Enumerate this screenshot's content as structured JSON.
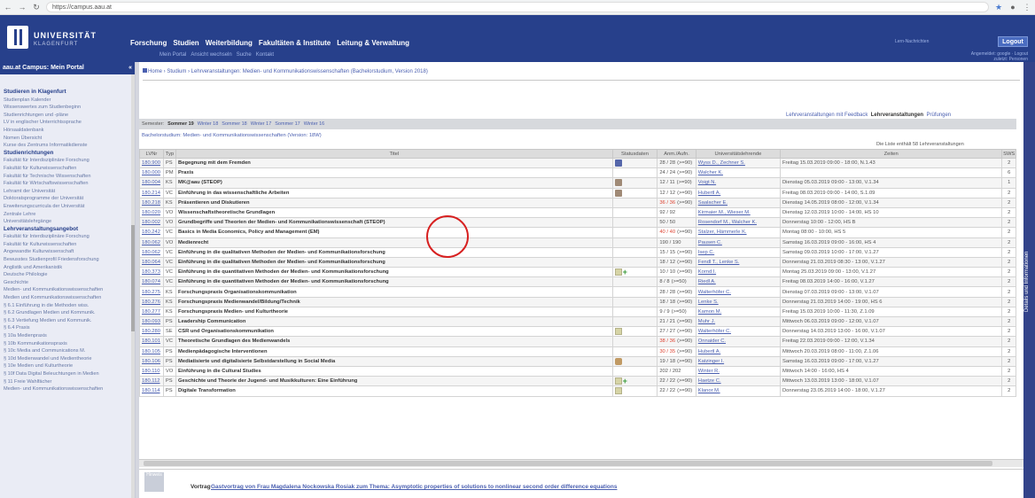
{
  "browser": {
    "url": "https://campus.aau.at"
  },
  "banner": {
    "logo_main": "UNIVERSITÄT",
    "logo_sub": "KLAGENFURT",
    "nav": [
      "Forschung",
      "Studien",
      "Weiterbildung",
      "Fakultäten & Institute",
      "Leitung & Verwaltung"
    ],
    "subnav": [
      "Mein Portal",
      "Ansicht wechseln",
      "Suche",
      "Kontakt"
    ],
    "top_right": "Lern-Nachrichten",
    "login_label": "Logout",
    "user_line1": "Angemeldet: google · Logout",
    "user_line2": "zuletzt: Personen"
  },
  "sidebar": {
    "title": "aau.at Campus: Mein Portal",
    "collapse": "«",
    "items": [
      {
        "text": "Studieren in Klagenfurt",
        "h": true
      },
      {
        "text": "Studienplan Kalender",
        "h": false
      },
      {
        "text": "Wissenswertes zum Studienbeginn",
        "h": false
      },
      {
        "text": "Studienrichtungen und -pläne",
        "h": false
      },
      {
        "text": "LV in englischer Unterrichtssprache",
        "h": false
      },
      {
        "text": "Hörsaaldatenbank",
        "h": false
      },
      {
        "text": "Nomen Übersicht",
        "h": false
      },
      {
        "text": "Kurse des Zentrums Informatikdienste",
        "h": false
      },
      {
        "text": "Studienrichtungen",
        "h": true
      },
      {
        "text": "Fakultät für Interdisziplinäre Forschung",
        "h": false
      },
      {
        "text": "Fakultät für Kulturwissenschaften",
        "h": false
      },
      {
        "text": "Fakultät für Technische Wissenschaften",
        "h": false
      },
      {
        "text": "Fakultät für Wirtschaftswissenschaften",
        "h": false
      },
      {
        "text": "Lehramt der Universität",
        "h": false
      },
      {
        "text": "Doktoratsprogramme der Universität",
        "h": false
      },
      {
        "text": "Erweiterungscurricula der Universität",
        "h": false
      },
      {
        "text": "Zentrale Lehre",
        "h": false
      },
      {
        "text": "Universitätslehrgänge",
        "h": false
      },
      {
        "text": "Lehrveranstaltungsangebot",
        "h": true
      },
      {
        "text": "Fakultät für Interdisziplinäre Forschung",
        "h": false
      },
      {
        "text": "Fakultät für Kulturwissenschaften",
        "h": false
      },
      {
        "text": "Angewandte Kulturwissenschaft",
        "h": false
      },
      {
        "text": "Bewusstes Studienprofil Friedensforschung",
        "h": false
      },
      {
        "text": "Anglistik und Amerikanistik",
        "h": false
      },
      {
        "text": "Deutsche Philologie",
        "h": false
      },
      {
        "text": "Geschichte",
        "h": false
      },
      {
        "text": "Medien- und Kommunikationswissenschaften",
        "h": false
      },
      {
        "text": "Medien und Kommunikationswissenschaften",
        "h": false
      },
      {
        "text": "§ 6.1 Einführung in die Methoden wiss.",
        "h": false
      },
      {
        "text": "§ 6.2 Grundlagen Medien und Kommunik.",
        "h": false
      },
      {
        "text": "§ 6.3 Vertiefung Medien und Kommunik.",
        "h": false
      },
      {
        "text": "§ 6.4 Praxis",
        "h": false
      },
      {
        "text": "§ 10a Medienpraxis",
        "h": false
      },
      {
        "text": "§ 10b Kommunikationspraxis",
        "h": false
      },
      {
        "text": "§ 10c Media and Communications M.",
        "h": false
      },
      {
        "text": "§ 10d Medienwandel und Medientheorie",
        "h": false
      },
      {
        "text": "§ 10e Medien und Kulturtheorie",
        "h": false
      },
      {
        "text": "§ 10f Data Digital Beleuchtungen in Medien",
        "h": false
      },
      {
        "text": "§ 11 Freie Wahlfächer",
        "h": false
      },
      {
        "text": "Medien- und Kommunikationswissenschaften",
        "h": false
      }
    ]
  },
  "breadcrumb": "Home › Studium › Lehrveranstaltungen: Medien- und Kommunikationswissenschaften (Bachelorstudium, Version 2018)",
  "right_tabs": {
    "feedback": "Lehrveranstaltungen mit Feedback",
    "active": "Lehrveranstaltungen",
    "pruefungen": "Prüfungen"
  },
  "semester": {
    "label": "Semester:",
    "items": [
      "Sommer 19",
      "Winter 18",
      "Sommer 18",
      "Winter 17",
      "Sommer 17",
      "Winter 16"
    ]
  },
  "study_link": "Bachelorstudium: Medien- und Kommunikationswissenschaften (Version: 18W)",
  "count_text": "Die Liste enthält 58 Lehrveranstaltungen",
  "table": {
    "headers": [
      "LVNr",
      "Typ",
      "Titel",
      "Statusdaten",
      "Anm./Aufn.",
      "Universitätslehrende",
      "Zeiten",
      "SWS"
    ],
    "rows": [
      {
        "nr": "180.900",
        "typ": "PS",
        "titel": "Begegnung mit dem Fremden",
        "status": "book",
        "anm": "28 / 28",
        "anm2": "(>=90)",
        "lehr": "Wyss D., Zechner S.",
        "zeit": "Freitag 15.03.2019 09:00 - 18:00, N.1.43",
        "sws": "2"
      },
      {
        "nr": "180.000",
        "typ": "PM",
        "titel": "Praxis",
        "status": "",
        "anm": "24 / 24",
        "anm2": "(>=90)",
        "lehr": "Walcher K.",
        "zeit": "",
        "sws": "6"
      },
      {
        "nr": "180.004",
        "typ": "KS",
        "titel": "MK@aau (STEOP)",
        "status": "box",
        "anm": "12 / 11",
        "anm2": "(>=90)",
        "lehr": "Voigt N.",
        "zeit": "Dienstag 05.03.2019 09:00 - 13:00, V.1.34",
        "sws": "1"
      },
      {
        "nr": "180.214",
        "typ": "VC",
        "titel": "Einführung in das wissenschaftliche Arbeiten",
        "status": "box",
        "anm": "12 / 12",
        "anm2": "(>=90)",
        "lehr": "Hubertl A.",
        "zeit": "Freitag 08.03.2019 09:00 - 14:00, S.1.09",
        "sws": "2"
      },
      {
        "nr": "180.218",
        "typ": "KS",
        "titel": "Präsentieren und Diskutieren",
        "status": "",
        "anm": "36 / 36",
        "anm2": "(>=90)",
        "lehr": "Saalacher E.",
        "zeit": "Dienstag 14.05.2019 08:00 - 12:00, V.1.34",
        "sws": "2",
        "red": true
      },
      {
        "nr": "180.020",
        "typ": "VO",
        "titel": "Wissenschaftstheoretische Grundlagen",
        "status": "",
        "anm": "92 / 92",
        "anm2": "",
        "lehr": "Kirmaier M., Wieser M.",
        "zeit": "Dienstag 12.03.2019 10:00 - 14:00, HS 10",
        "sws": "2"
      },
      {
        "nr": "180.002",
        "typ": "VO",
        "titel": "Grundbegriffe und Theorien der Medien- und Kommunikationswissenschaft (STEOP)",
        "status": "",
        "anm": "50 / 50",
        "anm2": "",
        "lehr": "Rosendorf M., Walcher K.",
        "zeit": "Donnerstag 10:00 - 12:00, HS B",
        "sws": "2"
      },
      {
        "nr": "180.242",
        "typ": "VC",
        "titel": "Basics in Media Economics, Policy and Management (EM)",
        "status": "",
        "anm": "40 / 40",
        "anm2": "(>=90)",
        "lehr": "Stalzer, Hämmerle K.",
        "zeit": "Montag 08:00 - 10:00, HS 5",
        "sws": "2",
        "red": true
      },
      {
        "nr": "180.062",
        "typ": "VO",
        "titel": "Medienrecht",
        "status": "",
        "anm": "190 / 190",
        "anm2": "",
        "lehr": "Pausen C.",
        "zeit": "Samstag 16.03.2019 09:00 - 16:00, HS 4",
        "sws": "2"
      },
      {
        "nr": "180.062",
        "typ": "VC",
        "titel": "Einführung in die qualitativen Methoden der Medien- und Kommunikationsforschung",
        "status": "",
        "anm": "15 / 15",
        "anm2": "(>=90)",
        "lehr": "Isep C.",
        "zeit": "Samstag 09.03.2019 10:00 - 17:00, V.1.27",
        "sws": "2"
      },
      {
        "nr": "180.064",
        "typ": "VC",
        "titel": "Einführung in die qualitativen Methoden der Medien- und Kommunikationsforschung",
        "status": "",
        "anm": "18 / 12",
        "anm2": "(>=90)",
        "lehr": "Fendl T., Lenke S.",
        "zeit": "Donnerstag 21.03.2019 08:30 - 13:00, V.1.27",
        "sws": "2"
      },
      {
        "nr": "180.373",
        "typ": "VC",
        "titel": "Einführung in die quantitativen Methoden der Medien- und Kommunikationsforschung",
        "status": "docplus",
        "anm": "10 / 10",
        "anm2": "(>=90)",
        "lehr": "Kornd I.",
        "zeit": "Montag 25.03.2019 09:00 - 13:00, V.1.27",
        "sws": "2"
      },
      {
        "nr": "180.074",
        "typ": "VC",
        "titel": "Einführung in die quantitativen Methoden der Medien- und Kommunikationsforschung",
        "status": "",
        "anm": "8 / 8",
        "anm2": "(>=50)",
        "lehr": "Riedl A.",
        "zeit": "Freitag 08.03.2019 14:00 - 16:00, V.1.27",
        "sws": "2"
      },
      {
        "nr": "180.275",
        "typ": "KS",
        "titel": "Forschungspraxis Organisationskommunikation",
        "status": "",
        "anm": "28 / 28",
        "anm2": "(>=90)",
        "lehr": "Walterhöfer C.",
        "zeit": "Dienstag 07.03.2019 09:00 - 13:00, V.1.07",
        "sws": "2"
      },
      {
        "nr": "180.276",
        "typ": "KS",
        "titel": "Forschungspraxis Medienwandel/Bildung/Technik",
        "status": "",
        "anm": "18 / 18",
        "anm2": "(>=90)",
        "lehr": "Lenke S.",
        "zeit": "Donnerstag 21.03.2019 14:00 - 19:00, HS 6",
        "sws": "2"
      },
      {
        "nr": "180.277",
        "typ": "KS",
        "titel": "Forschungspraxis Medien- und Kulturtheorie",
        "status": "",
        "anm": "9 / 9",
        "anm2": "(>=50)",
        "lehr": "Kamon M.",
        "zeit": "Freitag 15.03.2019 10:00 - 11:30, Z.1.09",
        "sws": "2"
      },
      {
        "nr": "180.093",
        "typ": "PS",
        "titel": "Leadership Communication",
        "status": "",
        "anm": "21 / 21",
        "anm2": "(>=90)",
        "lehr": "Muhr J.",
        "zeit": "Mittwoch 06.03.2019 09:00 - 12:00, V.1.07",
        "sws": "2"
      },
      {
        "nr": "180.280",
        "typ": "SE",
        "titel": "CSR und Organisationskommunikation",
        "status": "doc",
        "anm": "27 / 27",
        "anm2": "(>=90)",
        "lehr": "Walterhöfer C.",
        "zeit": "Donnerstag 14.03.2019 13:00 - 16:00, V.1.07",
        "sws": "2"
      },
      {
        "nr": "180.101",
        "typ": "VC",
        "titel": "Theoretische Grundlagen des Medienwandels",
        "status": "",
        "anm": "38 / 36",
        "anm2": "(>=90)",
        "lehr": "Onnaider C.",
        "zeit": "Freitag 22.03.2019 09:00 - 12:00, V.1.34",
        "sws": "2",
        "red": true
      },
      {
        "nr": "180.105",
        "typ": "PS",
        "titel": "Medienpädagogische Interventionen",
        "status": "",
        "anm": "30 / 35",
        "anm2": "(>=90)",
        "lehr": "Hubertl A.",
        "zeit": "Mittwoch 20.03.2019 08:00 - 11:00, Z.1.06",
        "sws": "2",
        "red": true
      },
      {
        "nr": "180.106",
        "typ": "PS",
        "titel": "Mediatisierte und digitalisierte Selbstdarstellung in Social Media",
        "status": "hand",
        "anm": "19 / 18",
        "anm2": "(>=90)",
        "lehr": "Katzinger I.",
        "zeit": "Samstag 16.03.2019 09:00 - 17:00, V.1.27",
        "sws": "2"
      },
      {
        "nr": "180.110",
        "typ": "VO",
        "titel": "Einführung in die Cultural Studies",
        "status": "",
        "anm": "202 / 202",
        "anm2": "",
        "lehr": "Winter R.",
        "zeit": "Mittwoch 14:00 - 16:00, HS 4",
        "sws": "2"
      },
      {
        "nr": "180.112",
        "typ": "PS",
        "titel": "Geschichte und Theorie der Jugend- und Musikkulturen: Eine Einführung",
        "status": "docplus",
        "anm": "22 / 22",
        "anm2": "(>=90)",
        "lehr": "Haetze C.",
        "zeit": "Mittwoch 13.03.2019 13:00 - 18:00, V.1.07",
        "sws": "2"
      },
      {
        "nr": "180.114",
        "typ": "PS",
        "titel": "Digitale Transformation",
        "status": "doc",
        "anm": "22 / 22",
        "anm2": "(>=90)",
        "lehr": "Klanor M.",
        "zeit": "Donnerstag 23.05.2019 14:00 - 18:00, V.1.27",
        "sws": "2"
      }
    ]
  },
  "bottom": {
    "badge": "Hinweis",
    "label": "Vortrag",
    "title": "Gastvortrag von Frau Magdalena Nockowska Rosiak zum Thema: Asymptotic properties of solutions to nonlinear second order difference equations"
  },
  "right_panel": "Details und Informationen"
}
